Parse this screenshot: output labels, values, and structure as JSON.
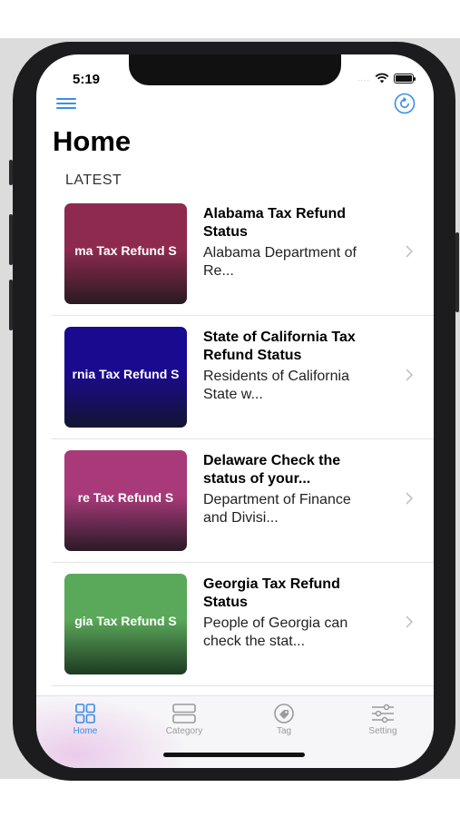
{
  "status_bar": {
    "time": "5:19",
    "carrier_dots": "...."
  },
  "header": {
    "title": "Home"
  },
  "section": {
    "label": "LATEST"
  },
  "items": [
    {
      "thumb_text": "ma Tax Refund S",
      "title": "Alabama Tax Refund Status",
      "subtitle": "Alabama Department of Re...",
      "thumb_color": "#8e2a4f"
    },
    {
      "thumb_text": "rnia Tax Refund S",
      "title": "State of California Tax Refund Status",
      "subtitle": "Residents of California State w...",
      "thumb_color": "#1a0a8f"
    },
    {
      "thumb_text": "re Tax Refund S",
      "title": "Delaware Check the status of your...",
      "subtitle": "Department of Finance and Divisi...",
      "thumb_color": "#a83a7a"
    },
    {
      "thumb_text": "gia Tax Refund S",
      "title": "Georgia Tax Refund Status",
      "subtitle": "People of Georgia can check the stat...",
      "thumb_color": "#5aa85a"
    }
  ],
  "tabbar": {
    "tabs": [
      {
        "label": "Home",
        "icon": "grid-icon",
        "active": true
      },
      {
        "label": "Category",
        "icon": "category-icon",
        "active": false
      },
      {
        "label": "Tag",
        "icon": "tag-icon",
        "active": false
      },
      {
        "label": "Setting",
        "icon": "sliders-icon",
        "active": false
      }
    ]
  },
  "colors": {
    "accent": "#3a8ee6",
    "inactive": "#9a9a9a"
  }
}
